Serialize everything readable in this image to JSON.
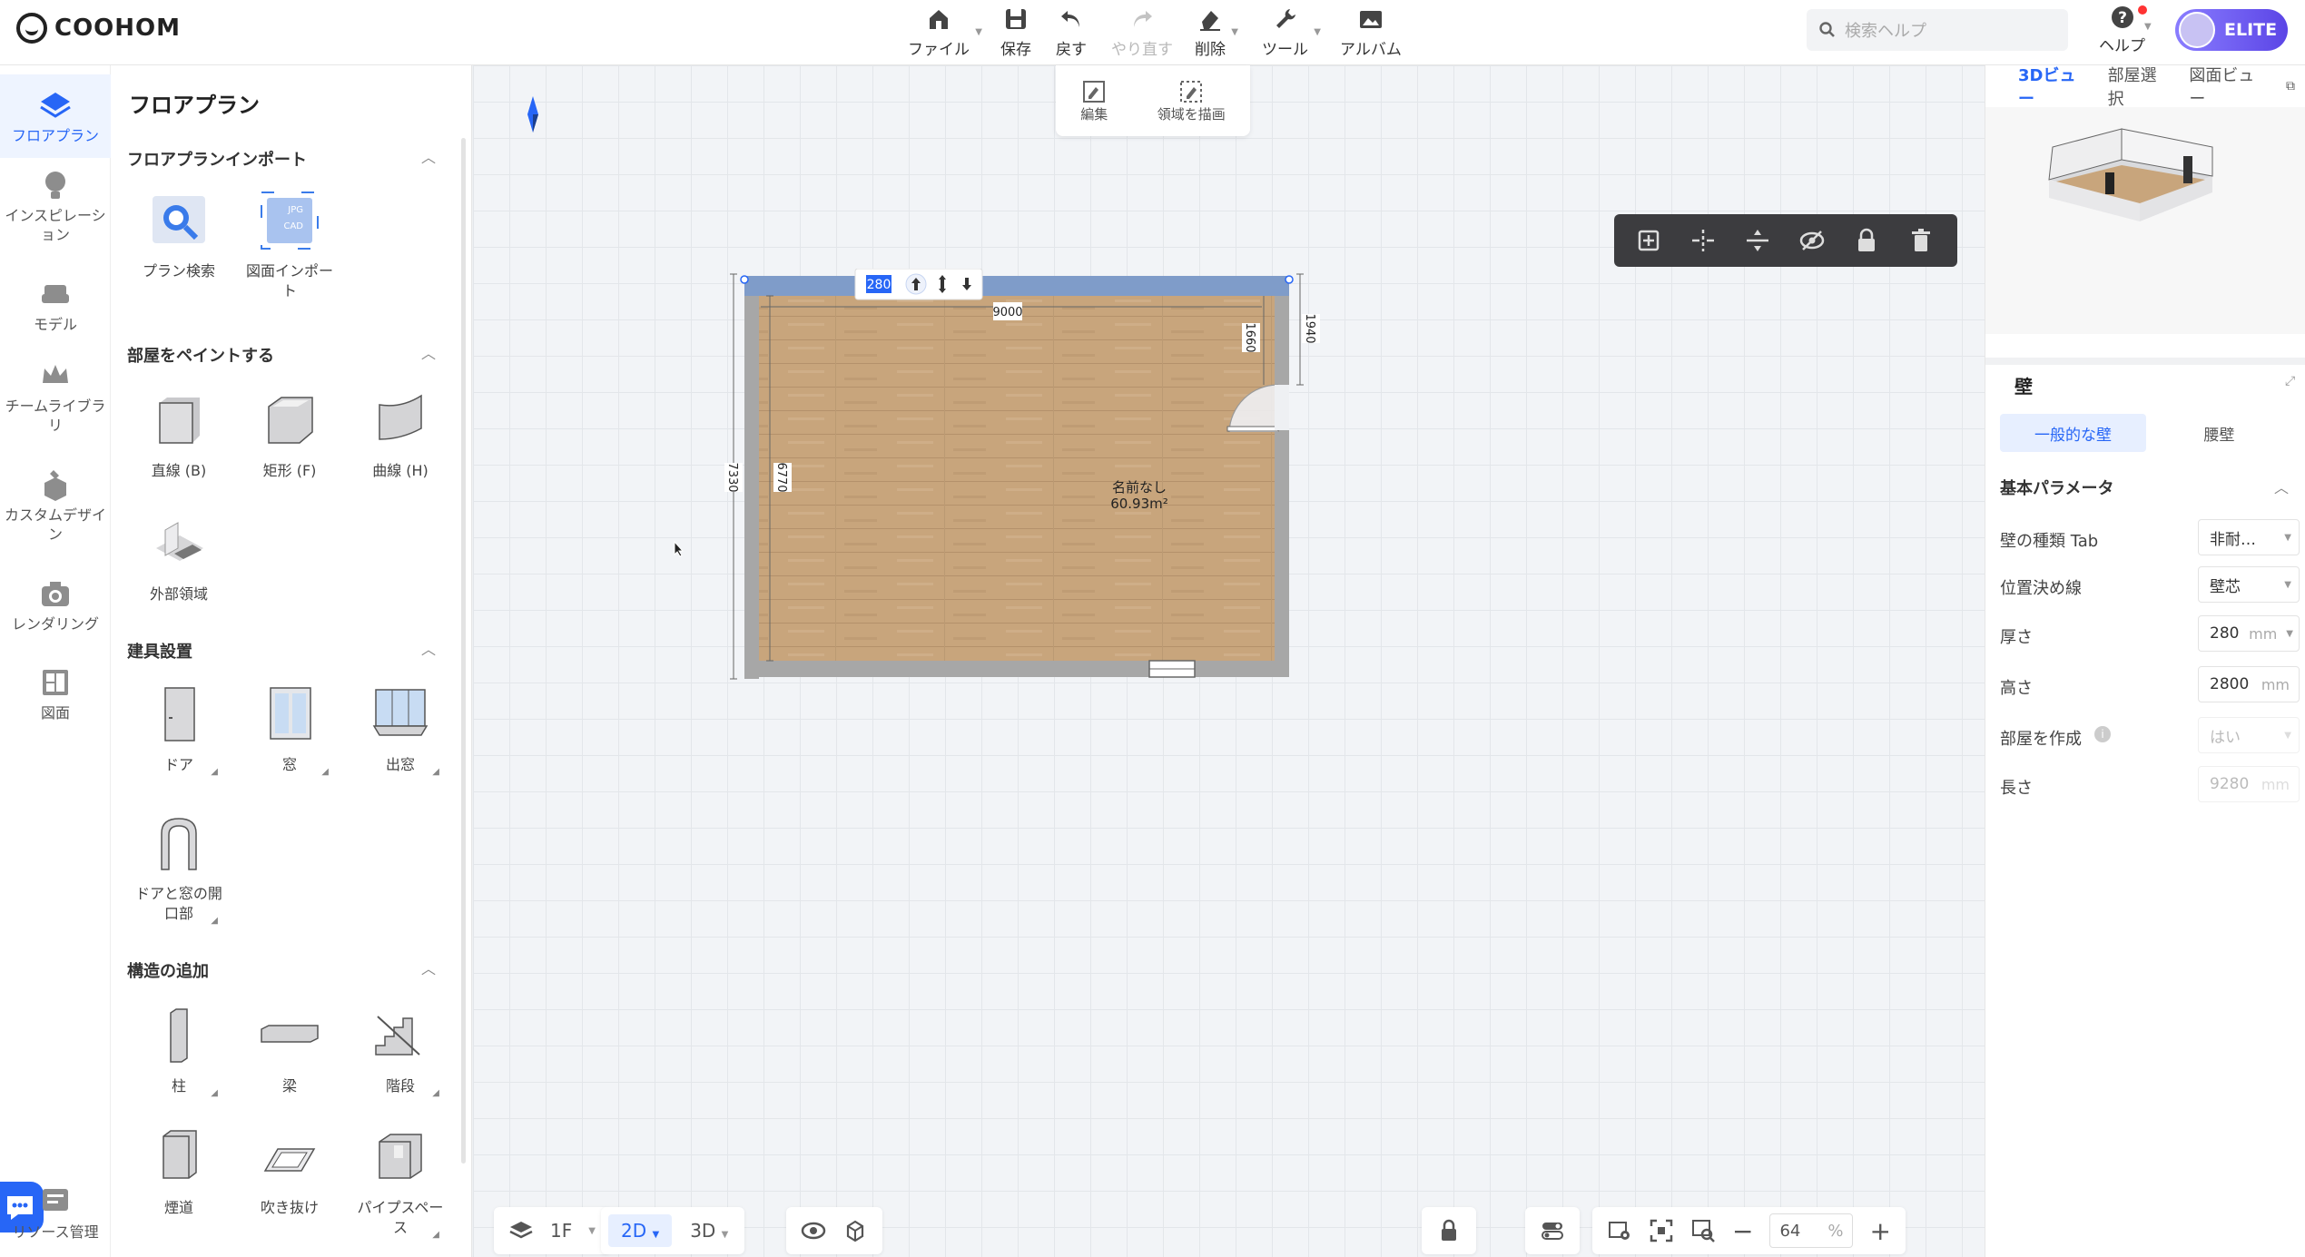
{
  "app": {
    "logo_text": "COOHOM",
    "plan_label": "ELITE"
  },
  "toolbar": {
    "file": "ファイル",
    "save": "保存",
    "undo": "戻す",
    "redo": "やり直す",
    "delete": "削除",
    "tools": "ツール",
    "album": "アルバム"
  },
  "search": {
    "placeholder": "検索ヘルプ"
  },
  "help": {
    "label": "ヘルプ"
  },
  "rail": {
    "floorplan": "フロアプラン",
    "inspiration": "インスピレーション",
    "model": "モデル",
    "team_library": "チームライブラリ",
    "custom_design": "カスタムデザイン",
    "rendering": "レンダリング",
    "drawing": "図面",
    "resources": "リソース管理"
  },
  "panel": {
    "title": "フロアプラン",
    "import": {
      "title": "フロアプランインポート",
      "plan_search": "プラン検索",
      "drawing_import": "図面インポート"
    },
    "paint": {
      "title": "部屋をペイントする",
      "straight": "直線 (B)",
      "rect": "矩形 (F)",
      "curve": "曲線 (H)",
      "outer_area": "外部領域"
    },
    "fixtures": {
      "title": "建具設置",
      "door": "ドア",
      "window": "窓",
      "bay_window": "出窓",
      "opening": "ドアと窓の開口部"
    },
    "structure": {
      "title": "構造の追加",
      "column": "柱",
      "beam": "梁",
      "stairs": "階段",
      "flue": "煙道",
      "void": "吹き抜け",
      "pipe_space": "パイプスペース"
    }
  },
  "edit_toolbar": {
    "edit": "編集",
    "draw_area": "領域を描画"
  },
  "plan": {
    "wall_thickness_input": "280",
    "dim_width": "9000",
    "dim_height_outer": "7330",
    "dim_height_inner": "6770",
    "dim_right_upper": "1660",
    "dim_right_outer": "1940",
    "room_name": "名前なし",
    "room_area": "60.93m²"
  },
  "bottom": {
    "floor": "1F",
    "mode_2d": "2D",
    "mode_3d": "3D",
    "zoom_value": "64",
    "zoom_unit": "%"
  },
  "right_panel": {
    "tabs": [
      "3Dビュー",
      "部屋選択",
      "図面ビュー"
    ],
    "section_title": "壁",
    "wall_tabs": [
      "一般的な壁",
      "腰壁"
    ],
    "params_title": "基本パラメータ",
    "params": [
      {
        "label": "壁の種類  Tab",
        "value": "非耐…",
        "unit": ""
      },
      {
        "label": "位置決め線",
        "value": "壁芯",
        "unit": ""
      },
      {
        "label": "厚さ",
        "value": "280",
        "unit": "mm"
      },
      {
        "label": "高さ",
        "value": "2800",
        "unit": "mm"
      },
      {
        "label": "部屋を作成",
        "value": "はい",
        "unit": ""
      },
      {
        "label": "長さ",
        "value": "9280",
        "unit": "mm"
      }
    ]
  },
  "colors": {
    "accent": "#2766f6",
    "wall": "#a7a7a7",
    "floor": "#c8a57c",
    "selected_wall": "#7f9cc9"
  }
}
